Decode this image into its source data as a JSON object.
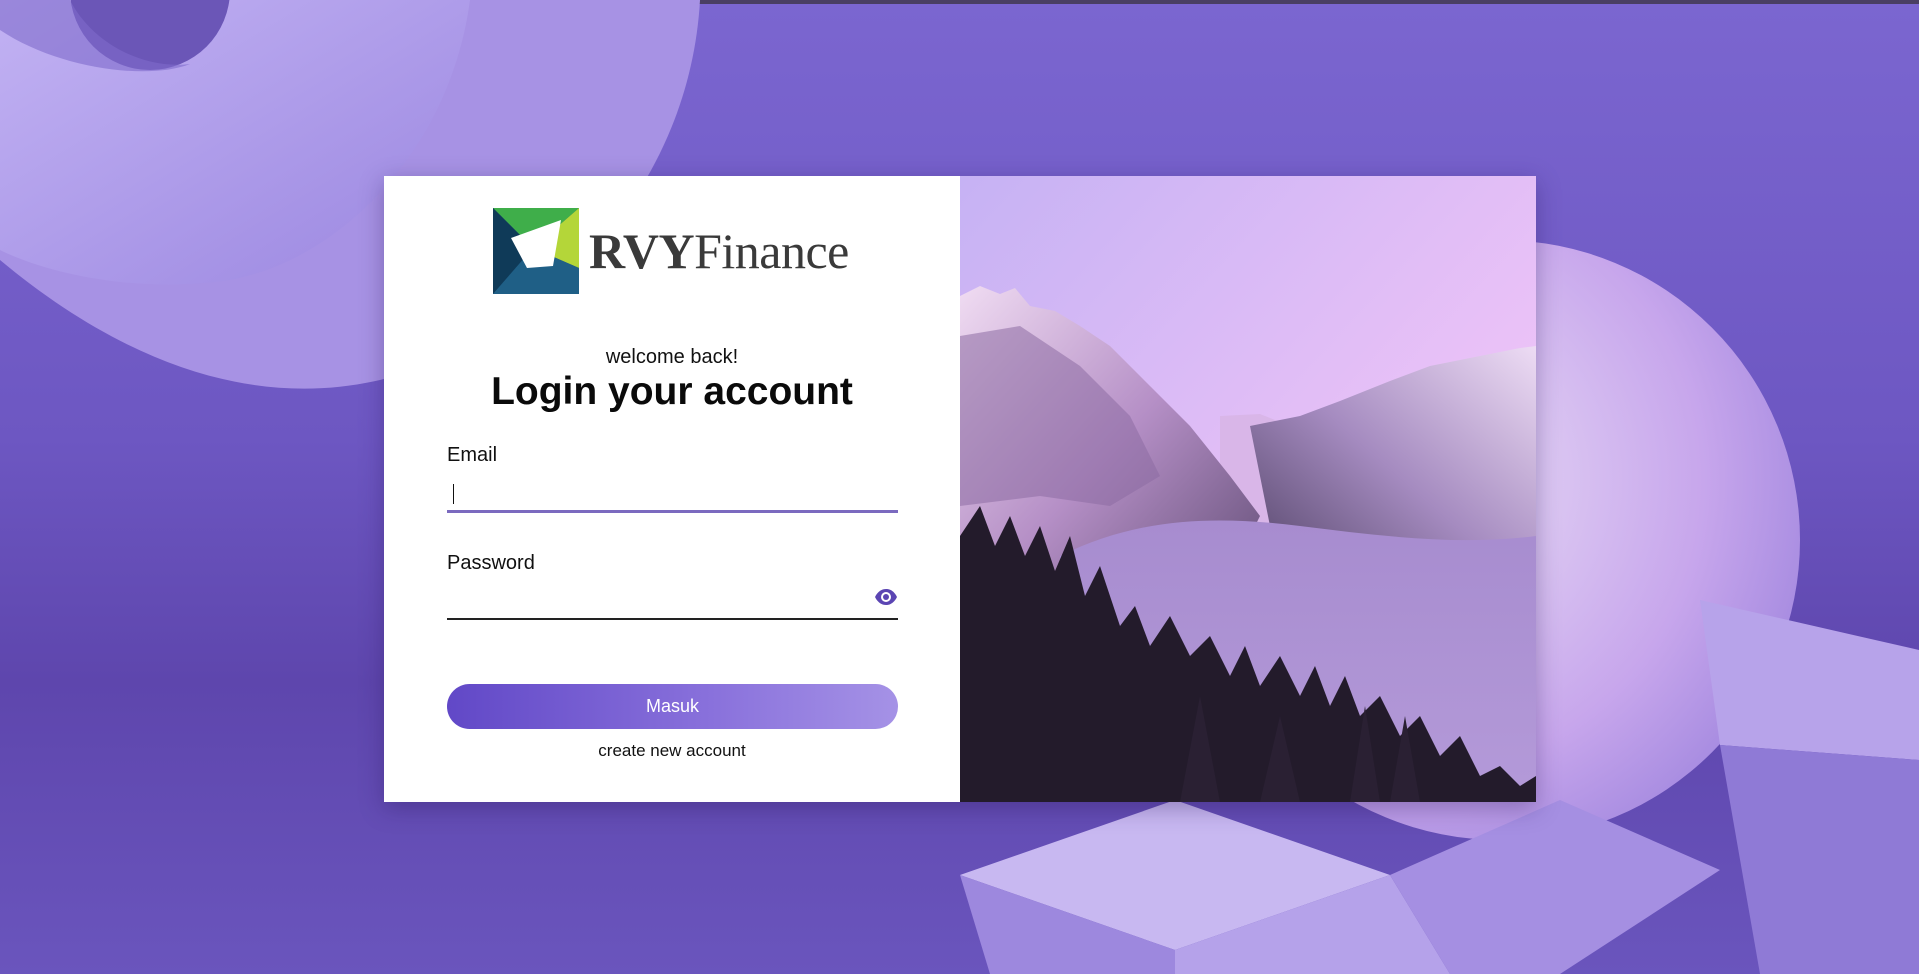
{
  "brand": {
    "name_bold": "RVY",
    "name_light": "Finance"
  },
  "login": {
    "welcome": "welcome back!",
    "title": "Login your account",
    "email_label": "Email",
    "email_value": "",
    "password_label": "Password",
    "password_value": "",
    "submit_label": "Masuk",
    "create_account_label": "create new account"
  },
  "colors": {
    "accent": "#6148c7",
    "background": "#7b66d0",
    "active_underline": "#7b6abf"
  }
}
